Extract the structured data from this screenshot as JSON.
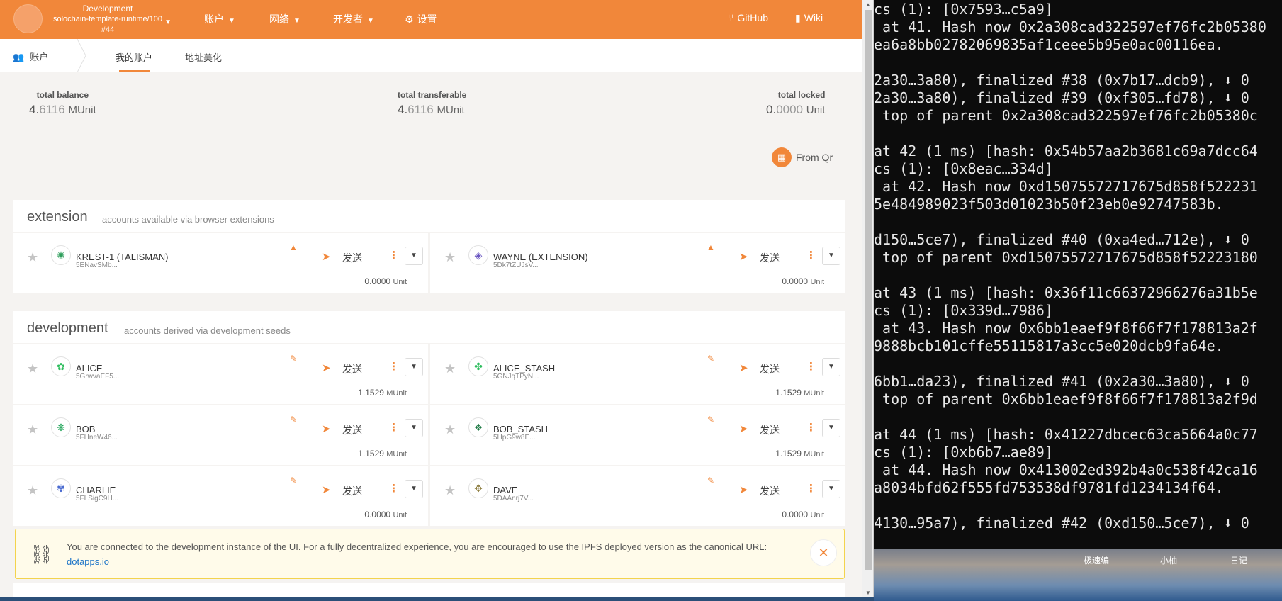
{
  "nav": {
    "chain_name": "Development",
    "runtime": "solochain-template-runtime/100",
    "block": "#44",
    "menu": [
      {
        "label": "账户",
        "has_caret": true
      },
      {
        "label": "网络",
        "has_caret": true
      },
      {
        "label": "开发者",
        "has_caret": true
      },
      {
        "label": "设置",
        "has_caret": false
      }
    ],
    "github": "GitHub",
    "wiki": "Wiki",
    "accent": "#f1873a"
  },
  "tabs": {
    "root": "账户",
    "items": [
      "我的账户",
      "地址美化"
    ],
    "active": "我的账户"
  },
  "summary": {
    "total_balance": {
      "label": "total balance",
      "main": "4.",
      "dim": "6116",
      "unit": "MUnit"
    },
    "total_transferable": {
      "label": "total transferable",
      "main": "4.",
      "dim": "6116",
      "unit": "MUnit"
    },
    "total_locked": {
      "label": "total locked",
      "main": "0.",
      "dim": "0000",
      "unit": "Unit"
    }
  },
  "from_qr": "From Qr",
  "extension": {
    "title": "extension",
    "desc": "accounts available via browser extensions",
    "accounts": [
      {
        "name": "KREST-1 (TALISMAN)",
        "addr": "5ENavSMb...",
        "badge": "warning-icon",
        "send": "发送",
        "bal": "0.0000",
        "unit": "Unit"
      },
      {
        "name": "WAYNE (EXTENSION)",
        "addr": "5Dk7tZUJsV...",
        "badge": "warning-icon",
        "send": "发送",
        "bal": "0.0000",
        "unit": "Unit"
      }
    ]
  },
  "development": {
    "title": "development",
    "desc": "accounts derived via development seeds",
    "accounts": [
      {
        "name": "ALICE",
        "addr": "5GrwvaEF5...",
        "badge": "wrench-icon",
        "send": "发送",
        "bal": "1.1529",
        "unit": "MUnit"
      },
      {
        "name": "ALICE_STASH",
        "addr": "5GNJqTPyN...",
        "badge": "wrench-icon",
        "send": "发送",
        "bal": "1.1529",
        "unit": "MUnit"
      },
      {
        "name": "BOB",
        "addr": "5FHneW46...",
        "badge": "wrench-icon",
        "send": "发送",
        "bal": "1.1529",
        "unit": "MUnit"
      },
      {
        "name": "BOB_STASH",
        "addr": "5HpG9w8E...",
        "badge": "wrench-icon",
        "send": "发送",
        "bal": "1.1529",
        "unit": "MUnit"
      },
      {
        "name": "CHARLIE",
        "addr": "5FLSigC9H...",
        "badge": "wrench-icon",
        "send": "发送",
        "bal": "0.0000",
        "unit": "Unit"
      },
      {
        "name": "DAVE",
        "addr": "5DAAnrj7V...",
        "badge": "wrench-icon",
        "send": "发送",
        "bal": "0.0000",
        "unit": "Unit"
      }
    ]
  },
  "notice": {
    "text": "You are connected to the development instance of the UI. For a fully decentralized experience, you are encouraged to use the IPFS deployed version as the canonical URL: ",
    "link": "dotapps.io"
  },
  "terminal": {
    "lines": [
      "cs (1): [0x7593…c5a9]",
      " at 41. Hash now 0x2a308cad322597ef76fc2b05380",
      "ea6a8bb02782069835af1ceee5b95e0ac00116ea.",
      "",
      "2a30…3a80), finalized #38 (0x7b17…dcb9), ⬇ 0",
      "2a30…3a80), finalized #39 (0xf305…fd78), ⬇ 0",
      " top of parent 0x2a308cad322597ef76fc2b05380c",
      "",
      "at 42 (1 ms) [hash: 0x54b57aa2b3681c69a7dcc64",
      "cs (1): [0x8eac…334d]",
      " at 42. Hash now 0xd15075572717675d858f522231",
      "5e484989023f503d01023b50f23eb0e92747583b.",
      "",
      "d150…5ce7), finalized #40 (0xa4ed…712e), ⬇ 0",
      " top of parent 0xd15075572717675d858f52223180",
      "",
      "at 43 (1 ms) [hash: 0x36f11c66372966276a31b5e",
      "cs (1): [0x339d…7986]",
      " at 43. Hash now 0x6bb1eaef9f8f66f7f178813a2f",
      "9888bcb101cffe55115817a3cc5e020dcb9fa64e.",
      "",
      "6bb1…da23), finalized #41 (0x2a30…3a80), ⬇ 0",
      " top of parent 0x6bb1eaef9f8f66f7f178813a2f9d",
      "",
      "at 44 (1 ms) [hash: 0x41227dbcec63ca5664a0c77",
      "cs (1): [0xb6b7…ae89]",
      " at 44. Hash now 0x413002ed392b4a0c538f42ca16",
      "a8034bfd62f555fd753538df9781fd1234134f64.",
      "",
      "4130…95a7), finalized #42 (0xd150…5ce7), ⬇ 0"
    ]
  },
  "desktop_labels": [
    "极速编",
    "小柚",
    "日记"
  ]
}
